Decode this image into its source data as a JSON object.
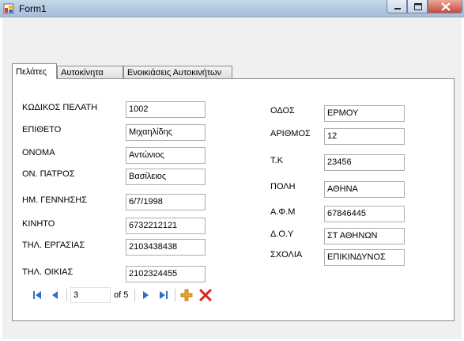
{
  "window": {
    "title": "Form1"
  },
  "tabs": [
    {
      "label": "Πελάτες",
      "active": true
    },
    {
      "label": "Αυτοκίνητα",
      "active": false
    },
    {
      "label": "Ενοικιάσεις Αυτοκινήτων",
      "active": false
    }
  ],
  "customer": {
    "left_fields": [
      {
        "label": "ΚΩΔΙΚΟΣ ΠΕΛΑΤΗ",
        "value": "1002"
      },
      {
        "label": "ΕΠΙΘΕΤΟ",
        "value": "Μιχαηλίδης"
      },
      {
        "label": "ΟΝΟΜΑ",
        "value": "Αντώνιος"
      },
      {
        "label": "ΟΝ. ΠΑΤΡΟΣ",
        "value": "Βασίλειος"
      },
      {
        "label": "ΗΜ. ΓΕΝΝΗΣΗΣ",
        "value": "6/7/1998"
      },
      {
        "label": "ΚΙΝΗΤΟ",
        "value": "6732212121"
      },
      {
        "label": "ΤΗΛ. ΕΡΓΑΣΙΑΣ",
        "value": "2103438438"
      },
      {
        "label": "ΤΗΛ. ΟΙΚΙΑΣ",
        "value": "2102324455"
      }
    ],
    "right_fields": [
      {
        "label": "ΟΔΟΣ",
        "value": "ΕΡΜΟΥ"
      },
      {
        "label": "ΑΡΙΘΜΟΣ",
        "value": "12"
      },
      {
        "label": "Τ.Κ",
        "value": "23456"
      },
      {
        "label": "ΠΟΛΗ",
        "value": "ΑΘΗΝΑ"
      },
      {
        "label": "Α.Φ.Μ",
        "value": "67846445"
      },
      {
        "label": "Δ.Ο.Υ",
        "value": "ΣΤ ΑΘΗΝΩΝ"
      },
      {
        "label": "ΣΧΟΛΙΑ",
        "value": "ΕΠΙΚΙΝΔΥΝΟΣ"
      }
    ]
  },
  "navigator": {
    "position": "3",
    "count_text": "of 5",
    "icons": [
      "move-first-icon",
      "move-previous-icon",
      "move-next-icon",
      "move-last-icon",
      "add-new-icon",
      "delete-icon"
    ]
  },
  "colors": {
    "titlebar": "#b4c9e2",
    "client_bg": "#f0f0f0",
    "nav_blue": "#2f6fbf",
    "add_orange": "#f0a11e",
    "delete_red": "#d9251c"
  }
}
